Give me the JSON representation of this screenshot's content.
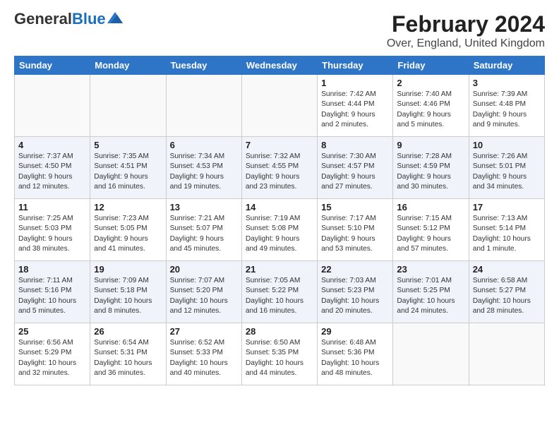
{
  "logo": {
    "general": "General",
    "blue": "Blue"
  },
  "title": "February 2024",
  "subtitle": "Over, England, United Kingdom",
  "days_of_week": [
    "Sunday",
    "Monday",
    "Tuesday",
    "Wednesday",
    "Thursday",
    "Friday",
    "Saturday"
  ],
  "weeks": [
    [
      {
        "day": "",
        "info": ""
      },
      {
        "day": "",
        "info": ""
      },
      {
        "day": "",
        "info": ""
      },
      {
        "day": "",
        "info": ""
      },
      {
        "day": "1",
        "info": "Sunrise: 7:42 AM\nSunset: 4:44 PM\nDaylight: 9 hours\nand 2 minutes."
      },
      {
        "day": "2",
        "info": "Sunrise: 7:40 AM\nSunset: 4:46 PM\nDaylight: 9 hours\nand 5 minutes."
      },
      {
        "day": "3",
        "info": "Sunrise: 7:39 AM\nSunset: 4:48 PM\nDaylight: 9 hours\nand 9 minutes."
      }
    ],
    [
      {
        "day": "4",
        "info": "Sunrise: 7:37 AM\nSunset: 4:50 PM\nDaylight: 9 hours\nand 12 minutes."
      },
      {
        "day": "5",
        "info": "Sunrise: 7:35 AM\nSunset: 4:51 PM\nDaylight: 9 hours\nand 16 minutes."
      },
      {
        "day": "6",
        "info": "Sunrise: 7:34 AM\nSunset: 4:53 PM\nDaylight: 9 hours\nand 19 minutes."
      },
      {
        "day": "7",
        "info": "Sunrise: 7:32 AM\nSunset: 4:55 PM\nDaylight: 9 hours\nand 23 minutes."
      },
      {
        "day": "8",
        "info": "Sunrise: 7:30 AM\nSunset: 4:57 PM\nDaylight: 9 hours\nand 27 minutes."
      },
      {
        "day": "9",
        "info": "Sunrise: 7:28 AM\nSunset: 4:59 PM\nDaylight: 9 hours\nand 30 minutes."
      },
      {
        "day": "10",
        "info": "Sunrise: 7:26 AM\nSunset: 5:01 PM\nDaylight: 9 hours\nand 34 minutes."
      }
    ],
    [
      {
        "day": "11",
        "info": "Sunrise: 7:25 AM\nSunset: 5:03 PM\nDaylight: 9 hours\nand 38 minutes."
      },
      {
        "day": "12",
        "info": "Sunrise: 7:23 AM\nSunset: 5:05 PM\nDaylight: 9 hours\nand 41 minutes."
      },
      {
        "day": "13",
        "info": "Sunrise: 7:21 AM\nSunset: 5:07 PM\nDaylight: 9 hours\nand 45 minutes."
      },
      {
        "day": "14",
        "info": "Sunrise: 7:19 AM\nSunset: 5:08 PM\nDaylight: 9 hours\nand 49 minutes."
      },
      {
        "day": "15",
        "info": "Sunrise: 7:17 AM\nSunset: 5:10 PM\nDaylight: 9 hours\nand 53 minutes."
      },
      {
        "day": "16",
        "info": "Sunrise: 7:15 AM\nSunset: 5:12 PM\nDaylight: 9 hours\nand 57 minutes."
      },
      {
        "day": "17",
        "info": "Sunrise: 7:13 AM\nSunset: 5:14 PM\nDaylight: 10 hours\nand 1 minute."
      }
    ],
    [
      {
        "day": "18",
        "info": "Sunrise: 7:11 AM\nSunset: 5:16 PM\nDaylight: 10 hours\nand 5 minutes."
      },
      {
        "day": "19",
        "info": "Sunrise: 7:09 AM\nSunset: 5:18 PM\nDaylight: 10 hours\nand 8 minutes."
      },
      {
        "day": "20",
        "info": "Sunrise: 7:07 AM\nSunset: 5:20 PM\nDaylight: 10 hours\nand 12 minutes."
      },
      {
        "day": "21",
        "info": "Sunrise: 7:05 AM\nSunset: 5:22 PM\nDaylight: 10 hours\nand 16 minutes."
      },
      {
        "day": "22",
        "info": "Sunrise: 7:03 AM\nSunset: 5:23 PM\nDaylight: 10 hours\nand 20 minutes."
      },
      {
        "day": "23",
        "info": "Sunrise: 7:01 AM\nSunset: 5:25 PM\nDaylight: 10 hours\nand 24 minutes."
      },
      {
        "day": "24",
        "info": "Sunrise: 6:58 AM\nSunset: 5:27 PM\nDaylight: 10 hours\nand 28 minutes."
      }
    ],
    [
      {
        "day": "25",
        "info": "Sunrise: 6:56 AM\nSunset: 5:29 PM\nDaylight: 10 hours\nand 32 minutes."
      },
      {
        "day": "26",
        "info": "Sunrise: 6:54 AM\nSunset: 5:31 PM\nDaylight: 10 hours\nand 36 minutes."
      },
      {
        "day": "27",
        "info": "Sunrise: 6:52 AM\nSunset: 5:33 PM\nDaylight: 10 hours\nand 40 minutes."
      },
      {
        "day": "28",
        "info": "Sunrise: 6:50 AM\nSunset: 5:35 PM\nDaylight: 10 hours\nand 44 minutes."
      },
      {
        "day": "29",
        "info": "Sunrise: 6:48 AM\nSunset: 5:36 PM\nDaylight: 10 hours\nand 48 minutes."
      },
      {
        "day": "",
        "info": ""
      },
      {
        "day": "",
        "info": ""
      }
    ]
  ]
}
